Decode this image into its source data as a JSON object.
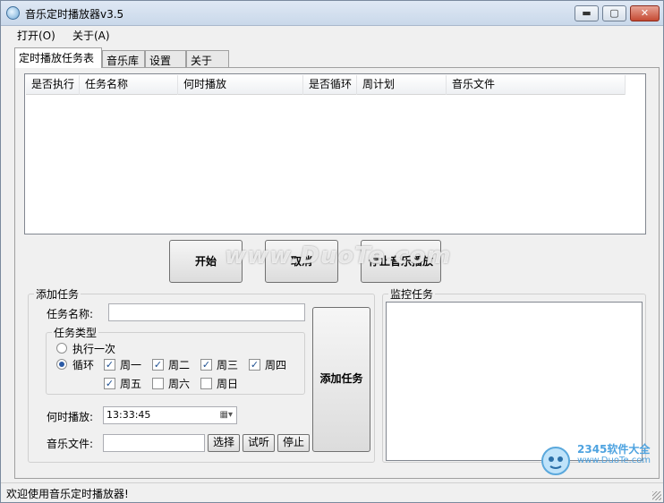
{
  "window": {
    "title": "音乐定时播放器v3.5",
    "min_label": "▬",
    "max_label": "▢",
    "close_label": "✕"
  },
  "menu": [
    "打开(O)",
    "关于(A)"
  ],
  "tabs": [
    "定时播放任务表",
    "音乐库",
    "设置",
    "关于"
  ],
  "task_table": {
    "columns": [
      "是否执行",
      "任务名称",
      "何时播放",
      "是否循环",
      "周计划",
      "音乐文件"
    ],
    "rows": []
  },
  "actions": {
    "start": "开始",
    "cancel": "取消",
    "stop_music": "停止音乐播放"
  },
  "add_task": {
    "group_title": "添加任务",
    "name_label": "任务名称:",
    "name_value": "",
    "type_group_title": "任务类型",
    "once_label": "执行一次",
    "loop_label": "循环",
    "selected_type": "循环",
    "weekdays": [
      {
        "label": "周一",
        "checked": true
      },
      {
        "label": "周二",
        "checked": true
      },
      {
        "label": "周三",
        "checked": true
      },
      {
        "label": "周四",
        "checked": true
      },
      {
        "label": "周五",
        "checked": true
      },
      {
        "label": "周六",
        "checked": false
      },
      {
        "label": "周日",
        "checked": false
      }
    ],
    "time_label": "何时播放:",
    "time_value": "13:33:45",
    "file_label": "音乐文件:",
    "file_value": "",
    "choose_button": "选择",
    "preview_button": "试听",
    "stop_button": "停止",
    "add_button": "添加任务"
  },
  "monitor": {
    "group_title": "监控任务"
  },
  "status": "欢迎使用音乐定时播放器!",
  "watermark": "www.DuoTe.com",
  "corner_logo": {
    "main": "2345软件大全",
    "sub": "www.DuoTe.com"
  }
}
